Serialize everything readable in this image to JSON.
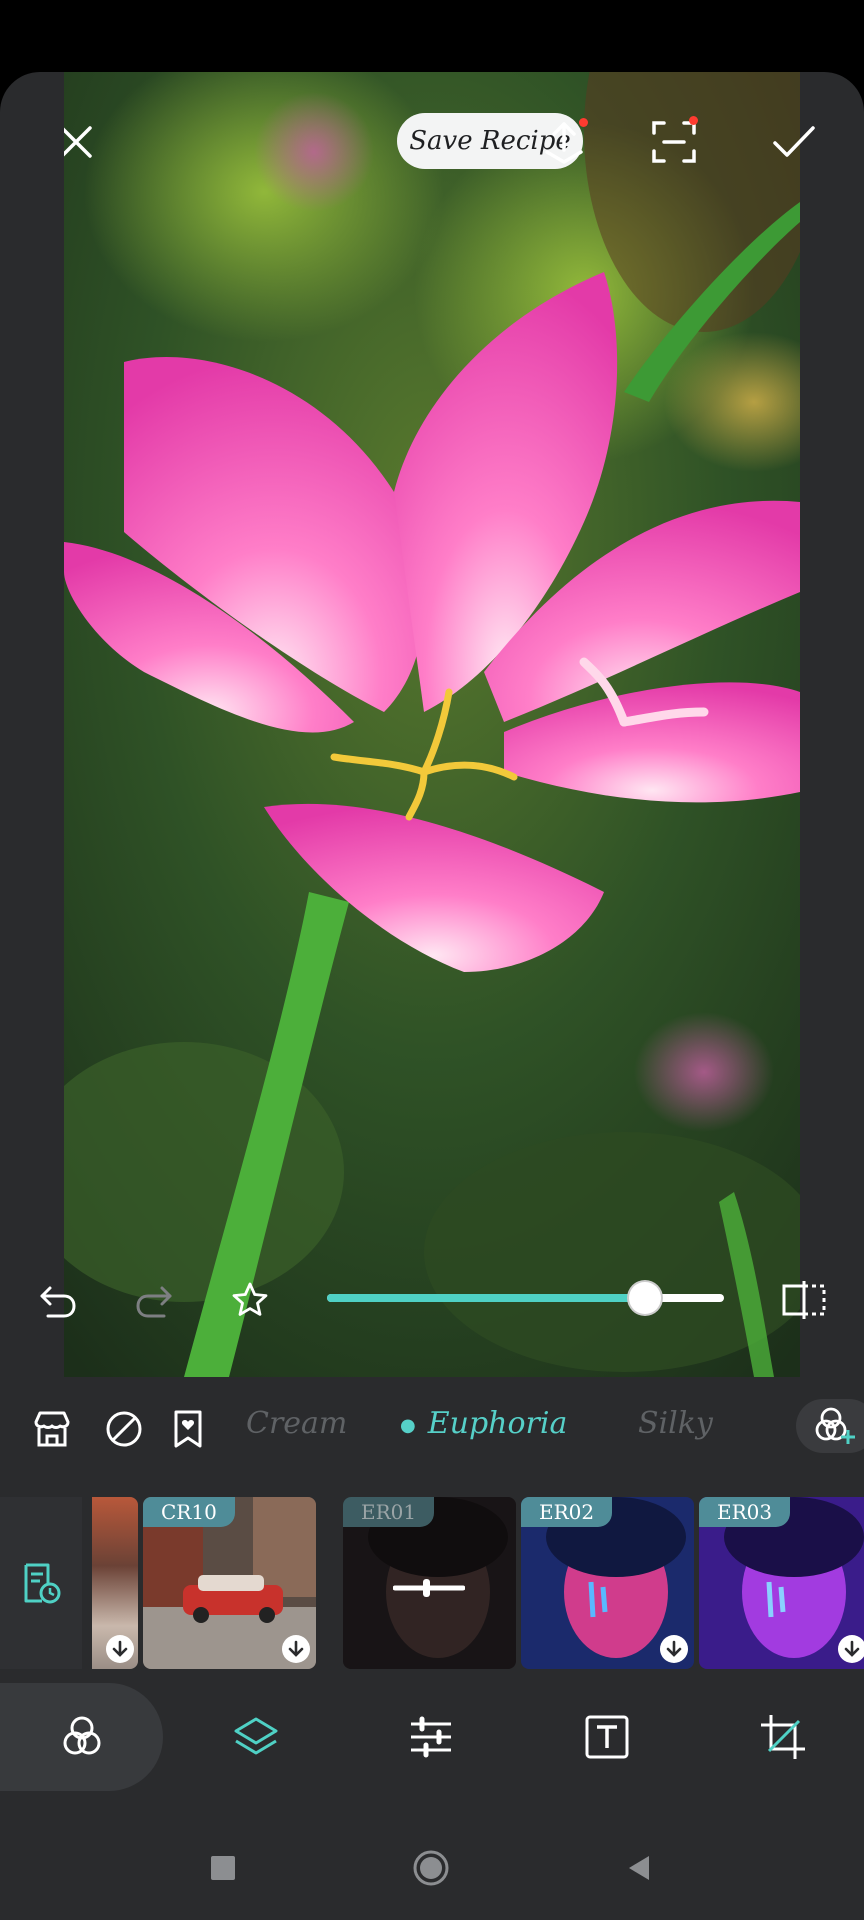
{
  "header": {
    "save_recipe_label": "Save Recipe"
  },
  "filter_categories": {
    "items": [
      "Cream",
      "Euphoria",
      "Silky"
    ],
    "active": "Euphoria"
  },
  "thumbnails": [
    {
      "label": ""
    },
    {
      "label": "CR10"
    },
    {
      "label": "ER01"
    },
    {
      "label": "ER02"
    },
    {
      "label": "ER03"
    }
  ],
  "intensity_slider": {
    "value": 0.8
  },
  "colors": {
    "accent": "#4fd1c5",
    "background": "#2a2b2d",
    "notification_dot": "#ff3b30"
  },
  "icons": {
    "close": "close-icon",
    "share": "share-upload-icon",
    "scan": "scan-frame-icon",
    "confirm": "check-icon",
    "undo": "undo-icon",
    "redo": "redo-icon",
    "favorite": "star-icon",
    "compare": "compare-split-icon",
    "store": "store-icon",
    "none": "no-filter-icon",
    "bookmark": "bookmark-heart-icon",
    "add_filter": "add-filter-icon",
    "history": "history-recipe-icon",
    "filters_tool": "filters-tool-icon",
    "layers_tool": "layers-tool-icon",
    "adjust_tool": "adjust-sliders-icon",
    "text_tool": "text-tool-icon",
    "crop_tool": "crop-tool-icon"
  }
}
